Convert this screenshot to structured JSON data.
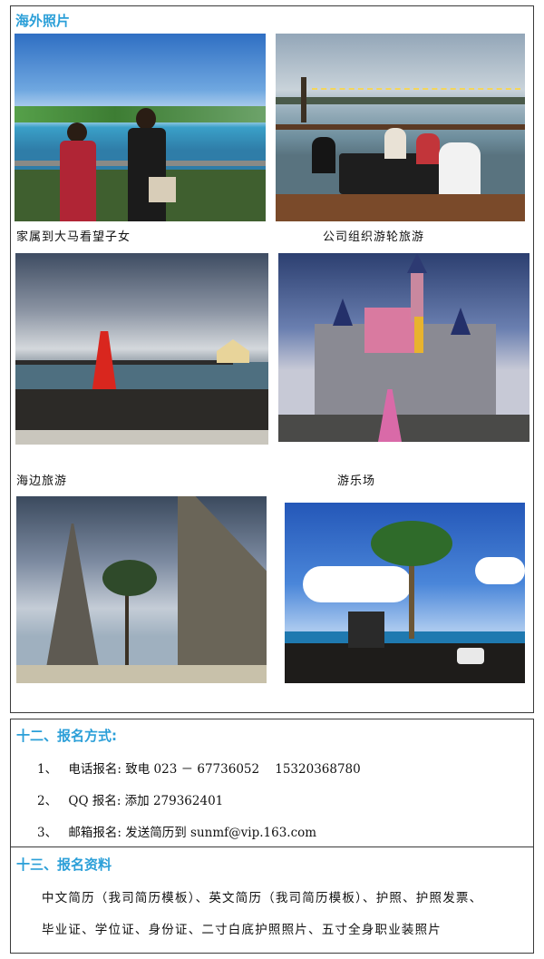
{
  "photos_section": {
    "title": "海外照片",
    "captions": {
      "malaysia": "家属到大马看望子女",
      "cruise": "公司组织游轮旅游",
      "seaside": "海边旅游",
      "park": "游乐场"
    }
  },
  "section12": {
    "title": "十二、报名方式:",
    "items": [
      {
        "num": "1、",
        "text": "电话报名: 致电 023 － 67736052    15320368780"
      },
      {
        "num": "2、",
        "text": "QQ 报名: 添加 279362401"
      },
      {
        "num": "3、",
        "text": "邮箱报名: 发送简历到 sunmf@vip.163.com"
      }
    ]
  },
  "section13": {
    "title": "十三、报名资料",
    "lines": [
      "中文简历（我司简历模板）、英文简历（我司简历模板）、护照、护照发票、",
      "毕业证、学位证、身份证、二寸白底护照照片、五寸全身职业装照片"
    ]
  },
  "colors": {
    "accent": "#2b9fd8",
    "border": "#3a3a3a"
  }
}
